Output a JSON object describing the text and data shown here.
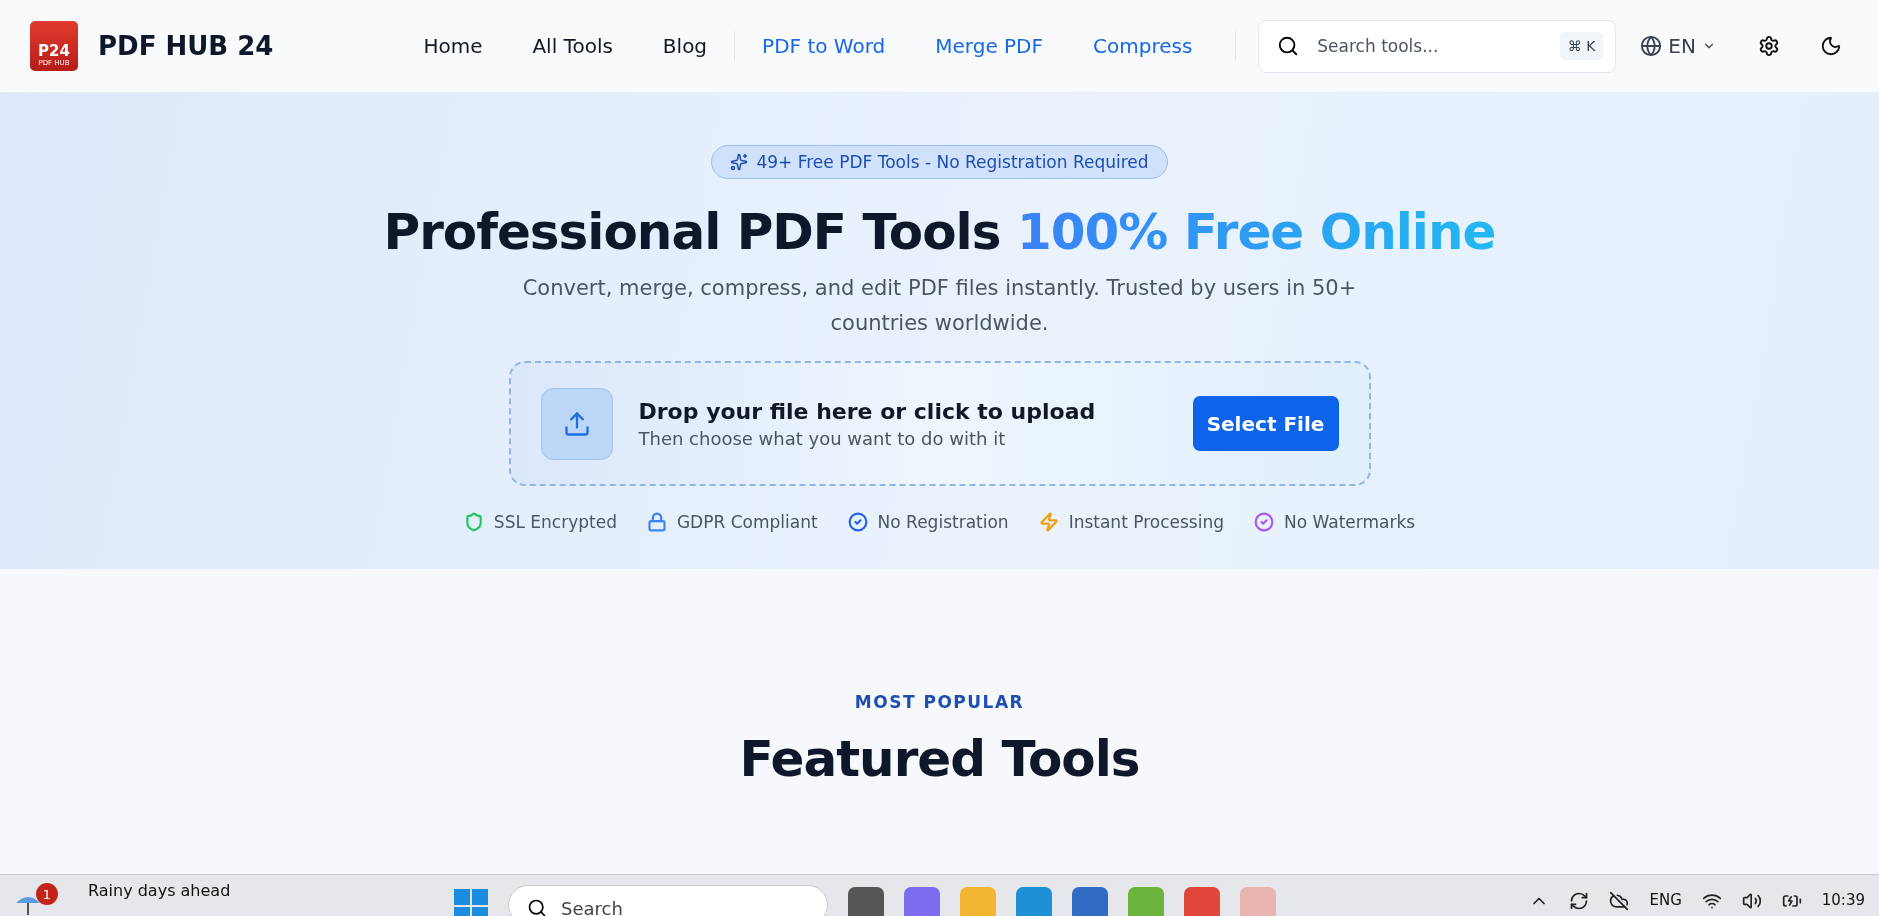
{
  "header": {
    "logo": {
      "mark": "P24",
      "mark_sub": "PDF HUB"
    },
    "brand": "PDF HUB 24",
    "nav": [
      {
        "label": "Home",
        "kind": "plain"
      },
      {
        "label": "All Tools",
        "kind": "plain"
      },
      {
        "label": "Blog",
        "kind": "plain"
      },
      {
        "label": "PDF to Word",
        "kind": "featured"
      },
      {
        "label": "Merge PDF",
        "kind": "featured"
      },
      {
        "label": "Compress",
        "kind": "featured"
      }
    ],
    "search": {
      "placeholder": "Search tools...",
      "shortcut_symbol": "⌘",
      "shortcut_key": "K"
    },
    "language": "EN"
  },
  "hero": {
    "badge": "49+ Free PDF Tools - No Registration Required",
    "title": "Professional PDF Tools",
    "title_highlight": "100% Free Online",
    "subtitle": "Convert, merge, compress, and edit PDF files instantly. Trusted by users in 50+ countries worldwide.",
    "upload": {
      "title": "Drop your file here or click to upload",
      "subtitle": "Then choose what you want to do with it",
      "button": "Select File"
    },
    "features": [
      {
        "label": "SSL Encrypted",
        "kind": "shield",
        "color": "#22c55e"
      },
      {
        "label": "GDPR Compliant",
        "kind": "lock",
        "color": "#3b82f6"
      },
      {
        "label": "No Registration",
        "kind": "check",
        "color": "#2563eb"
      },
      {
        "label": "Instant Processing",
        "kind": "bolt",
        "color": "#f59e0b"
      },
      {
        "label": "No Watermarks",
        "kind": "check",
        "color": "#a855f7"
      }
    ]
  },
  "section": {
    "eyebrow": "MOST POPULAR",
    "title": "Featured Tools"
  },
  "taskbar": {
    "weather": {
      "badge": "1",
      "text": "Rainy days ahead"
    },
    "search": "Search",
    "language": "ENG",
    "time": "10:39"
  }
}
